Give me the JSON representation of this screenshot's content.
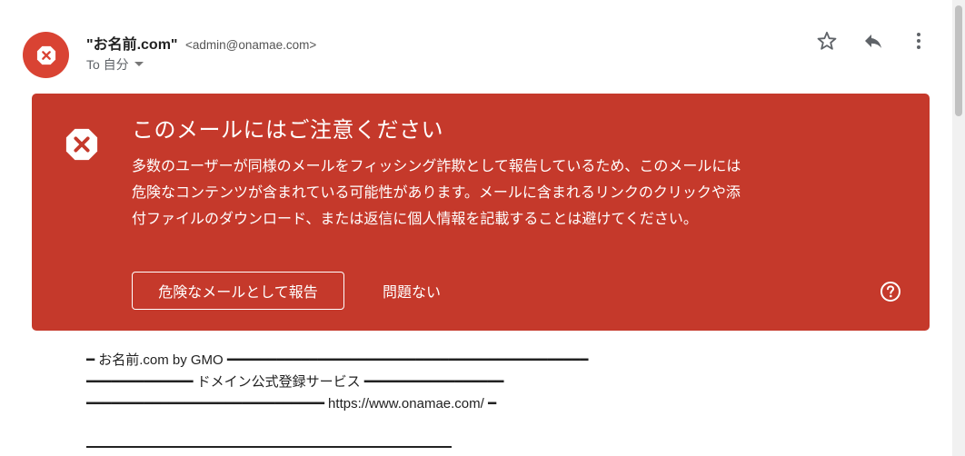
{
  "email": {
    "sender_name": "\"お名前.com\"",
    "sender_address": "<admin@onamae.com>",
    "recipient_label": "To 自分",
    "toolbar": {
      "star": "star-icon",
      "reply": "reply-icon",
      "more": "more-vert-icon"
    }
  },
  "warning": {
    "title": "このメールにはご注意ください",
    "message": "多数のユーザーが同様のメールをフィッシング詐欺として報告しているため、このメールには危険なコンテンツが含まれている可能性があります。メールに含まれるリンクのクリックや添付ファイルのダウンロード、または返信に個人情報を記載することは避けてください。",
    "report_button": "危険なメールとして報告",
    "dismiss_button": "問題ない",
    "help_icon": "help-icon",
    "color": "#c5392b"
  },
  "body": {
    "lines": [
      "━ お名前.com by GMO ━━━━━━━━━━━━━━━━━━━━━━━━━━━━━━━━━━━━━━━━━━━━",
      "━━━━━━━━━━━━━ ドメイン公式登録サービス ━━━━━━━━━━━━━━━━━",
      "━━━━━━━━━━━━━━━━━━━━━━━━━━━━━ https://www.onamae.com/ ━"
    ]
  }
}
